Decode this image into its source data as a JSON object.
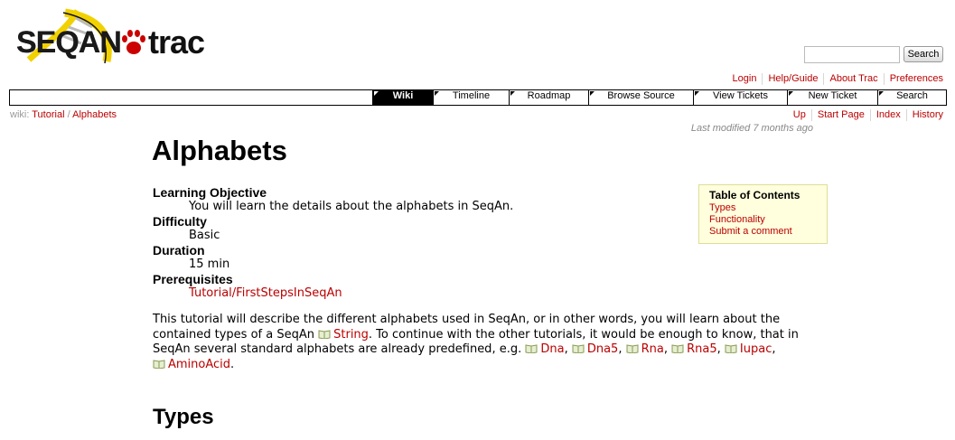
{
  "header": {
    "logo": {
      "name": "SEQAN",
      "product": "trac"
    },
    "search": {
      "value": "",
      "button_label": "Search"
    }
  },
  "metanav": [
    "Login",
    "Help/Guide",
    "About Trac",
    "Preferences"
  ],
  "mainnav": {
    "tabs": [
      {
        "label": "Wiki",
        "active": true
      },
      {
        "label": "Timeline"
      },
      {
        "label": "Roadmap"
      },
      {
        "label": "Browse Source"
      },
      {
        "label": "View Tickets"
      },
      {
        "label": "New Ticket"
      },
      {
        "label": "Search"
      }
    ]
  },
  "breadcrumb": {
    "prefix": "wiki:",
    "parts": [
      "Tutorial",
      "/",
      "Alphabets"
    ]
  },
  "ctxtnav": [
    "Up",
    "Start Page",
    "Index",
    "History"
  ],
  "last_modified": "Last modified 7 months ago",
  "page": {
    "title": "Alphabets",
    "deflist": [
      {
        "term": "Learning Objective",
        "desc": "You will learn the details about the alphabets in SeqAn."
      },
      {
        "term": "Difficulty",
        "desc": "Basic"
      },
      {
        "term": "Duration",
        "desc": "15 min"
      },
      {
        "term": "Prerequisites",
        "desc": "Tutorial/FirstStepsInSeqAn",
        "link": true
      }
    ],
    "intro": {
      "t1": "This tutorial will describe the different alphabets used in SeqAn, or in other words, you will learn about the contained types of a SeqAn ",
      "link_string": "String",
      "t2": ". To continue with the other tutorials, it would be enough to know, that in SeqAn several standard alphabets are already predefined, e.g. ",
      "links": [
        "Dna",
        "Dna5",
        "Rna",
        "Rna5",
        "Iupac",
        "AminoAcid"
      ],
      "sep": ", ",
      "end": "."
    },
    "toc": {
      "title": "Table of Contents",
      "items": [
        "Types",
        "Functionality",
        "Submit a comment"
      ]
    },
    "section_heading": "Types"
  },
  "colors": {
    "link": "#bb0000",
    "toc_bg": "#ffffdd",
    "active_tab": "#000000"
  },
  "icons": {
    "doc_link": "book-icon",
    "logo_paw": "paw-icon",
    "logo_helix": "dna-helix-icon"
  }
}
